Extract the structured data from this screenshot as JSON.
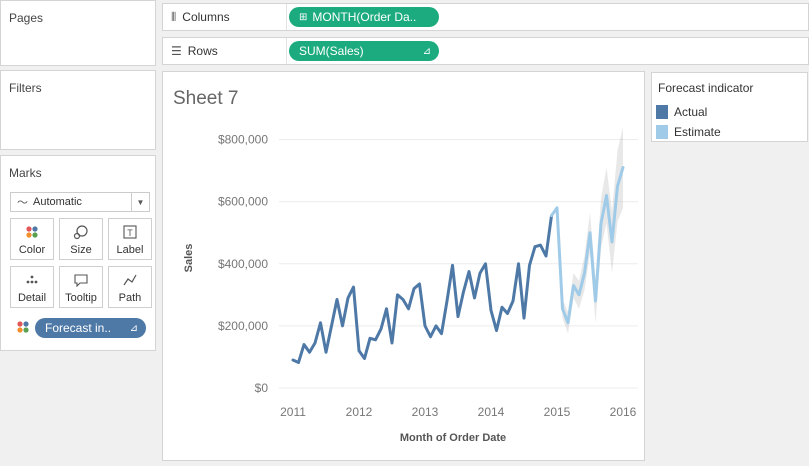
{
  "pages": {
    "title": "Pages"
  },
  "filters": {
    "title": "Filters"
  },
  "marks": {
    "title": "Marks",
    "mark_type": "Automatic",
    "buttons": [
      {
        "label": "Color",
        "icon": "color-dots-icon"
      },
      {
        "label": "Size",
        "icon": "size-icon"
      },
      {
        "label": "Label",
        "icon": "label-icon"
      },
      {
        "label": "Detail",
        "icon": "detail-icon"
      },
      {
        "label": "Tooltip",
        "icon": "tooltip-icon"
      },
      {
        "label": "Path",
        "icon": "path-icon"
      }
    ],
    "color_pill": "Forecast in.."
  },
  "shelves": {
    "columns_label": "Columns",
    "columns_pill": "MONTH(Order Da..",
    "rows_label": "Rows",
    "rows_pill": "SUM(Sales)"
  },
  "sheet": {
    "title": "Sheet 7"
  },
  "legend": {
    "title": "Forecast indicator",
    "items": [
      {
        "label": "Actual",
        "color": "#4e79a7"
      },
      {
        "label": "Estimate",
        "color": "#a0cbe8"
      }
    ]
  },
  "colors": {
    "pill": "#1bab7e",
    "actual": "#4e79a7",
    "estimate": "#a0cbe8",
    "band": "#bdbdbd"
  },
  "chart_data": {
    "type": "line",
    "xlabel": "Month of Order Date",
    "ylabel": "Sales",
    "x_ticks": [
      "2011",
      "2012",
      "2013",
      "2014",
      "2015",
      "2016"
    ],
    "y_ticks": [
      "$0",
      "$200,000",
      "$400,000",
      "$600,000",
      "$800,000"
    ],
    "ylim": [
      0,
      850000
    ],
    "grid": "horizontal-light",
    "series": [
      {
        "name": "Actual",
        "start": "2011-01",
        "values": [
          90000,
          82000,
          140000,
          115000,
          145000,
          210000,
          115000,
          200000,
          285000,
          200000,
          290000,
          325000,
          120000,
          95000,
          160000,
          155000,
          190000,
          255000,
          145000,
          300000,
          285000,
          255000,
          320000,
          335000,
          200000,
          165000,
          200000,
          175000,
          280000,
          395000,
          230000,
          310000,
          375000,
          290000,
          370000,
          400000,
          250000,
          185000,
          260000,
          240000,
          280000,
          400000,
          225000,
          395000,
          455000,
          460000,
          425000,
          555000
        ]
      },
      {
        "name": "Estimate",
        "start": "2014-12",
        "values": [
          555000,
          580000,
          255000,
          210000,
          330000,
          300000,
          370000,
          500000,
          280000,
          530000,
          620000,
          470000,
          650000,
          710000
        ],
        "band_halfwidth": [
          0,
          0,
          30000,
          35000,
          40000,
          45000,
          55000,
          65000,
          70000,
          80000,
          90000,
          100000,
          115000,
          130000
        ]
      }
    ]
  }
}
